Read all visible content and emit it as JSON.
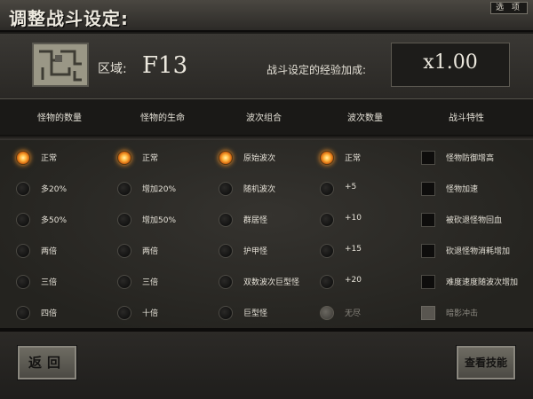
{
  "header": {
    "title": "调整战斗设定:",
    "options_label": "选 项"
  },
  "zone": {
    "label": "区域:",
    "value": "F13"
  },
  "bonus": {
    "label": "战斗设定的经验加成:",
    "value": "x1.00"
  },
  "columns": [
    {
      "header": "怪物的数量",
      "type": "radio",
      "selected": 0,
      "options": [
        "正常",
        "多20%",
        "多50%",
        "两倍",
        "三倍",
        "四倍"
      ]
    },
    {
      "header": "怪物的生命",
      "type": "radio",
      "selected": 0,
      "options": [
        "正常",
        "增加20%",
        "增加50%",
        "两倍",
        "三倍",
        "十倍"
      ]
    },
    {
      "header": "波次组合",
      "type": "radio",
      "selected": 0,
      "options": [
        "原始波次",
        "随机波次",
        "群居怪",
        "护甲怪",
        "双数波次巨型怪",
        "巨型怪"
      ]
    },
    {
      "header": "波次数量",
      "type": "radio",
      "selected": 0,
      "disabled": [
        5
      ],
      "options": [
        "正常",
        "+5",
        "+10",
        "+15",
        "+20",
        "无尽"
      ]
    },
    {
      "header": "战斗特性",
      "type": "checkbox",
      "disabled": [
        5
      ],
      "options": [
        "怪物防御增高",
        "怪物加速",
        "被砍退怪物回血",
        "砍退怪物消耗增加",
        "难度速度随波次增加",
        "暗影冲击"
      ]
    }
  ],
  "buttons": {
    "back": "返回",
    "skills": "查看技能"
  },
  "icons": {
    "map": "dungeon-minimap",
    "disabled_radio": "cracked-radio-icon",
    "disabled_check": "cracked-checkbox-icon"
  },
  "colors": {
    "accent_selected": "#ff9a2a",
    "panel_bg": "#2a2825",
    "text": "#e6e2d8"
  }
}
